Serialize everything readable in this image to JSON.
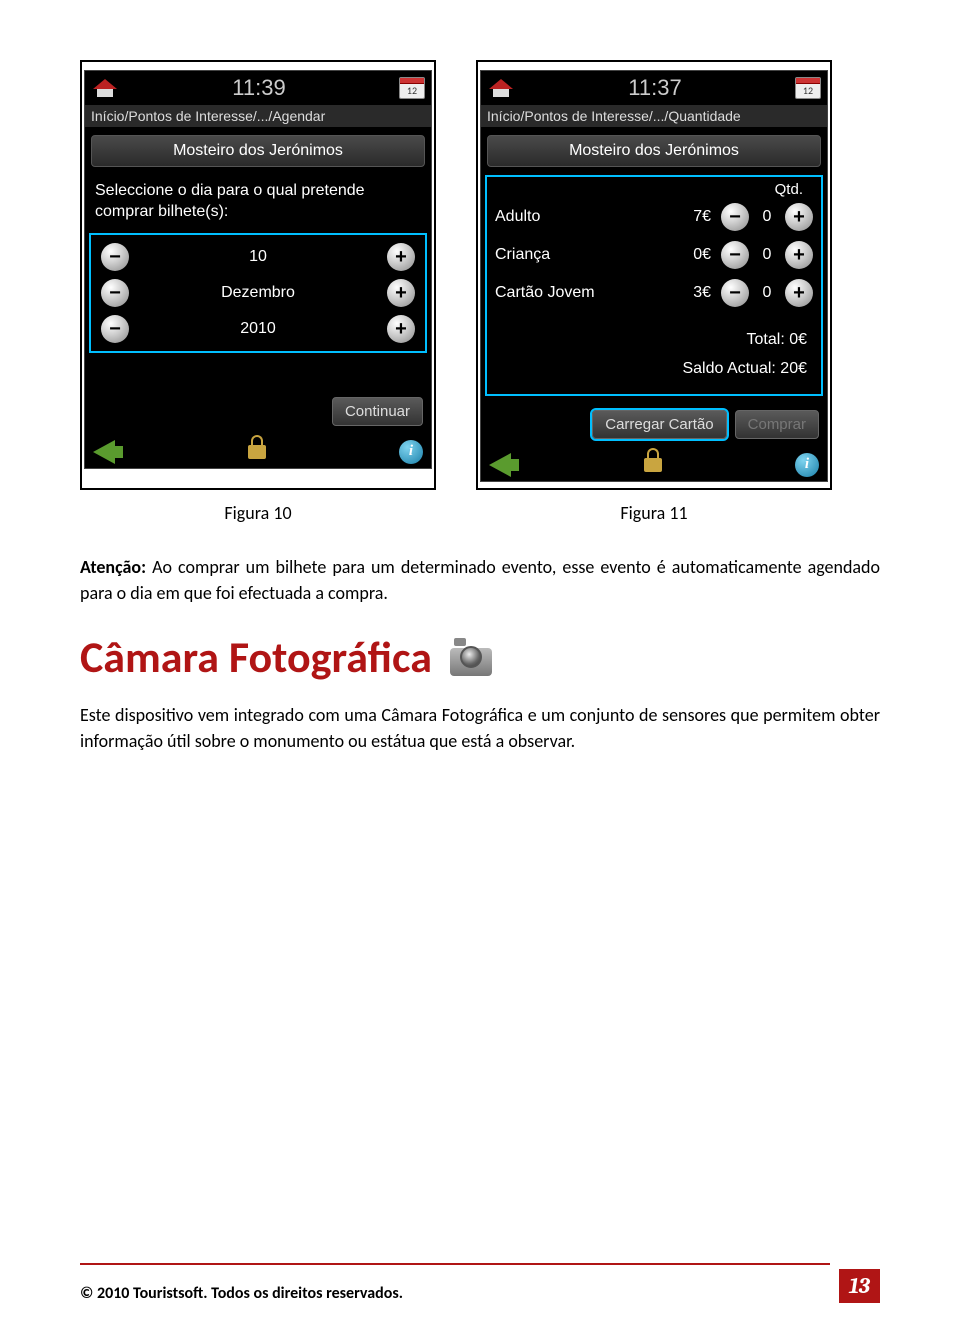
{
  "phone1": {
    "clock": "11:39",
    "cal_num": "12",
    "breadcrumb": "Início/Pontos de Interesse/.../Agendar",
    "panel_title": "Mosteiro dos Jerónimos",
    "instruction": "Seleccione o dia para o qual pretende comprar bilhete(s):",
    "day": "10",
    "month": "Dezembro",
    "year": "2010",
    "continue_label": "Continuar",
    "caption": "Figura 10"
  },
  "phone2": {
    "clock": "11:37",
    "cal_num": "12",
    "breadcrumb": "Início/Pontos de Interesse/.../Quantidade",
    "panel_title": "Mosteiro dos Jerónimos",
    "qty_header": "Qtd.",
    "rows": [
      {
        "label": "Adulto",
        "price": "7€",
        "qty": "0"
      },
      {
        "label": "Criança",
        "price": "0€",
        "qty": "0"
      },
      {
        "label": "Cartão Jovem",
        "price": "3€",
        "qty": "0"
      }
    ],
    "total_label": "Total: 0€",
    "balance_label": "Saldo Actual: 20€",
    "carregar_label": "Carregar Cartão",
    "comprar_label": "Comprar",
    "caption": "Figura 11"
  },
  "attention_text": "Atenção:",
  "attention_body": " Ao comprar um bilhete para um determinado evento, esse evento é automaticamente agendado para o dia em que foi efectuada a compra.",
  "heading": "Câmara Fotográfica",
  "body2": "Este dispositivo vem integrado com uma Câmara Fotográfica e um conjunto de sensores que permitem obter informação útil sobre o monumento ou estátua que está a observar.",
  "copyright": "© 2010 Touristsoft. Todos os direitos reservados.",
  "page_number": "13",
  "info_glyph": "i"
}
